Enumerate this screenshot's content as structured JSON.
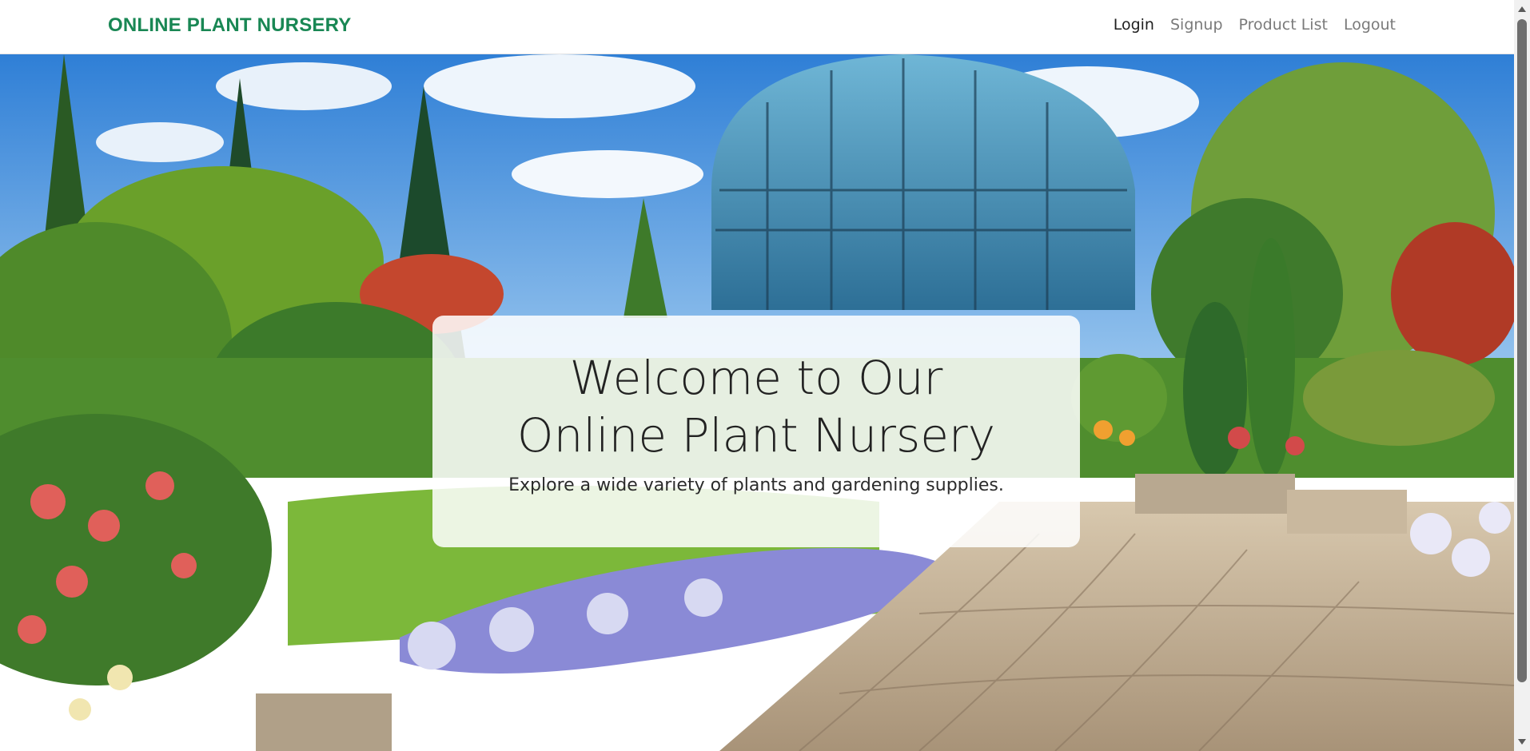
{
  "navbar": {
    "brand": "ONLINE PLANT NURSERY",
    "links": [
      "Login",
      "Signup",
      "Product List",
      "Logout"
    ],
    "active_link": "Login"
  },
  "hero": {
    "title": "Welcome to Our Online Plant Nursery",
    "subtitle": "Explore a wide variety of plants and gardening supplies.",
    "background_image": "botanical-garden-greenhouse"
  },
  "colors": {
    "brand": "#198754",
    "active_link": "#1f1f1f",
    "link": "#7a7a7a"
  }
}
